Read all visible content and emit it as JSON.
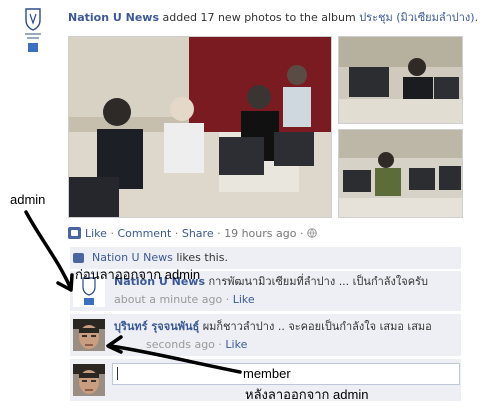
{
  "post": {
    "page_name": "Nation U News",
    "action_text": "added 17 new photos to the album",
    "album_name": "ประชุม (มิวเซียมลำปาง)",
    "album_suffix": "."
  },
  "actions": {
    "like": "Like",
    "sep1": "·",
    "comment": "Comment",
    "sep2": "·",
    "share": "Share",
    "sep3": "·",
    "time": "19 hours ago",
    "sep4": "·"
  },
  "likes_row": {
    "name": "Nation U News",
    "text": "likes this."
  },
  "comments": [
    {
      "author": "Nation U News",
      "text": "การพัฒนามิวเซียมที่ลำปาง ... เป็นกำลังใจครับ",
      "time": "about a minute ago",
      "sep": "·",
      "like": "Like"
    },
    {
      "author": "บุรินทร์ รุจจนพันธุ์",
      "text": "ผมก็ชาวลำปาง .. จะคอยเป็นกำลังใจ เสมอ เสมอ",
      "time": "seconds ago",
      "sep": "·",
      "like": "Like"
    }
  ],
  "annotations": {
    "admin_left": "admin",
    "logout_admin": "ก่อนลาออกจาก   admin",
    "member": "member",
    "after_logout": "หลังลาออกจาก   admin"
  },
  "colors": {
    "link": "#3b5998",
    "feedback_bg": "#edeff4",
    "brand": "#3b5998"
  }
}
